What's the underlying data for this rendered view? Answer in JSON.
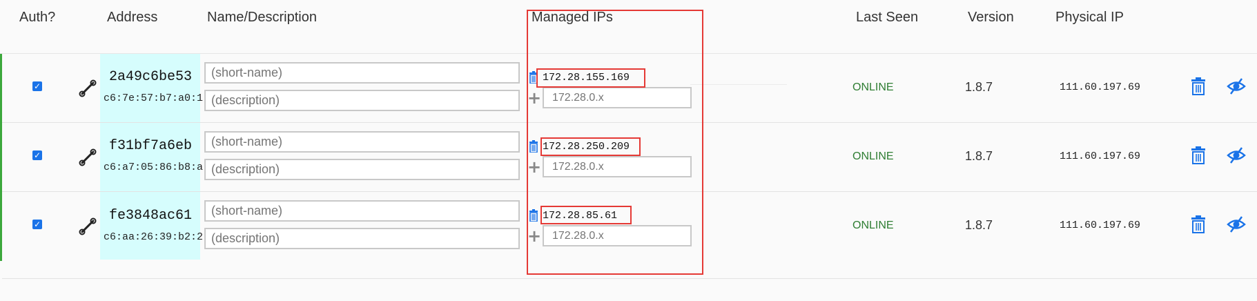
{
  "headers": {
    "auth": "Auth?",
    "address": "Address",
    "name": "Name/Description",
    "managed_ips": "Managed IPs",
    "last_seen": "Last Seen",
    "version": "Version",
    "physical_ip": "Physical IP"
  },
  "placeholders": {
    "short_name": "(short-name)",
    "description": "(description)",
    "ip": "172.28.0.x"
  },
  "colors": {
    "accent": "#1a73e8",
    "online": "#2e7d32",
    "highlight_box": "#e53935",
    "address_bg": "#d6fdfd",
    "authorized_bar": "#3ca83c"
  },
  "members": [
    {
      "authorized": true,
      "node_id": "2a49c6be53",
      "mac": "c6:7e:57:b7:a0:1",
      "managed_ip": "172.28.155.169",
      "status": "ONLINE",
      "version": "1.8.7",
      "physical_ip": "111.60.197.69"
    },
    {
      "authorized": true,
      "node_id": "f31bf7a6eb",
      "mac": "c6:a7:05:86:b8:a",
      "managed_ip": "172.28.250.209",
      "status": "ONLINE",
      "version": "1.8.7",
      "physical_ip": "111.60.197.69"
    },
    {
      "authorized": true,
      "node_id": "fe3848ac61",
      "mac": "c6:aa:26:39:b2:2",
      "managed_ip": "172.28.85.61",
      "status": "ONLINE",
      "version": "1.8.7",
      "physical_ip": "111.60.197.69"
    }
  ],
  "icons": {
    "edit": "wrench-icon",
    "delete_ip": "trash-icon",
    "add_ip": "plus-icon",
    "delete_member": "trash-icon",
    "hide": "eye-slash-icon"
  }
}
